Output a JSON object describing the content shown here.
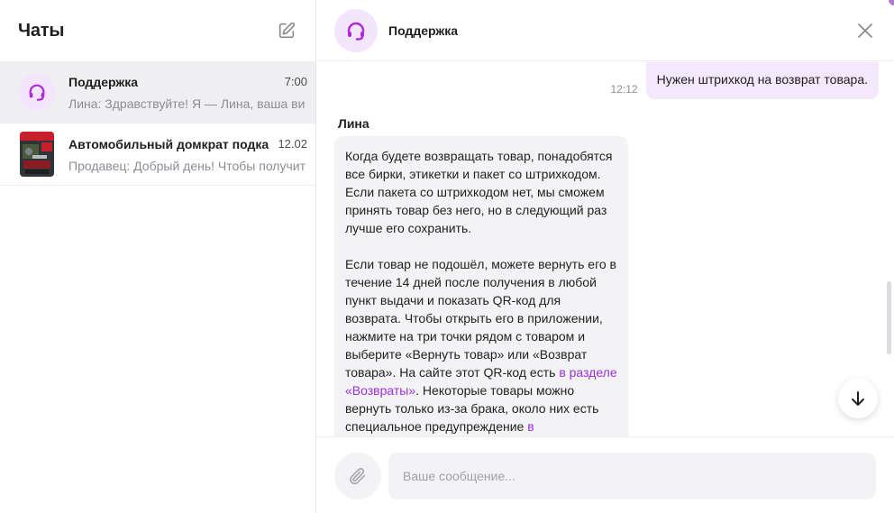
{
  "sidebar": {
    "title": "Чаты",
    "chats": [
      {
        "name": "Поддержка",
        "time": "7:00",
        "preview": "Лина: Здравствуйте! Я — Лина, ваша ви",
        "avatar_icon": "headset-icon",
        "active": true
      },
      {
        "name": "Автомобильный домкрат подкат",
        "time": "12.02",
        "preview": "Продавец: Добрый день! Чтобы получит",
        "avatar_icon": "product-thumbnail",
        "active": false
      }
    ]
  },
  "header": {
    "name": "Поддержка",
    "avatar_icon": "headset-icon"
  },
  "messages": {
    "outgoing": {
      "time": "12:12",
      "text": "Нужен штрихкод на возврат товара."
    },
    "incoming": {
      "sender": "Лина",
      "paragraph1": "Когда будете возвращать товар, понадобятся все бирки, этикетки и пакет со штрихкодом. Если пакета со штрихкодом нет, мы сможем принять товар без него, но в следующий раз лучше его сохранить.",
      "paragraph2_part1": "Если товар не подошёл, можете вернуть его в течение 14 дней после получения в любой пункт выдачи и показать QR-код для возврата. Чтобы открыть его в приложении, нажмите на три точки рядом с товаром и выберите «Вернуть товар» или «Возврат товара». На сайте этот QR-код есть ",
      "link1": "в разделе «Возвраты»",
      "paragraph2_part2": ". Некоторые товары можно вернуть только из-за брака, около них есть специальное предупреждение ",
      "link2": "в"
    }
  },
  "composer": {
    "placeholder": "Ваше сообщение..."
  },
  "colors": {
    "accent": "#9b2fd6",
    "active_chat_bg": "#efeff2",
    "outgoing_bubble": "#f3e8fc",
    "incoming_bubble": "#f3f3f6"
  }
}
